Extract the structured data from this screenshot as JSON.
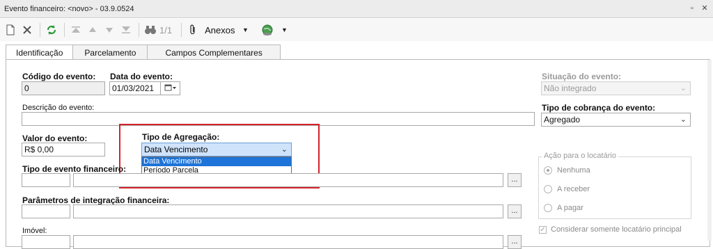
{
  "window": {
    "title": "Evento financeiro: <novo> - 03.9.0524",
    "restore_symbol": "▫",
    "close_symbol": "✕"
  },
  "toolbar": {
    "new_icon": "new-document-icon",
    "delete_icon": "delete-icon",
    "refresh_icon": "refresh-icon",
    "first_icon": "first-record-icon",
    "prev_icon": "previous-record-icon",
    "next_icon": "next-record-icon",
    "last_icon": "last-record-icon",
    "search_icon": "binoculars-icon",
    "record_position": "1/1",
    "attachments_label": "Anexos",
    "globe_icon": "globe-icon"
  },
  "tabs": [
    {
      "label": "Identificação",
      "active": true
    },
    {
      "label": "Parcelamento",
      "active": false
    },
    {
      "label": "Campos Complementares",
      "active": false
    }
  ],
  "form": {
    "codigo": {
      "label": "Código do evento:",
      "value": "0"
    },
    "data": {
      "label": "Data do evento:",
      "value": "01/03/2021"
    },
    "situacao": {
      "label": "Situação do evento:",
      "value": "Não integrado"
    },
    "descricao": {
      "label": "Descrição do evento:",
      "value": ""
    },
    "tipo_cobranca": {
      "label": "Tipo de cobrança do evento:",
      "value": "Agregado"
    },
    "valor": {
      "label": "Valor do evento:",
      "value": "R$ 0,00"
    },
    "tipo_agregacao": {
      "label": "Tipo de Agregação:",
      "value": "Data Vencimento",
      "options": [
        "Data Vencimento",
        "Período Parcela"
      ],
      "highlighted_option": "Data Vencimento"
    },
    "tipo_evento_fin": {
      "label": "Tipo de evento financeiro:",
      "code": "",
      "name": ""
    },
    "parametros": {
      "label": "Parâmetros de integração financeira:",
      "code": "",
      "name": ""
    },
    "imovel": {
      "label": "Imóvel:",
      "code": "",
      "name": ""
    },
    "browse_label": "...",
    "acao": {
      "title": "Ação para o locatário",
      "options": [
        "Nenhuma",
        "A receber",
        "A pagar"
      ],
      "selected": "Nenhuma"
    },
    "considerar": {
      "label": "Considerar somente locatário principal",
      "checked": true
    }
  },
  "colors": {
    "highlight_box": "#d4222a",
    "selection": "#1e74d8"
  }
}
